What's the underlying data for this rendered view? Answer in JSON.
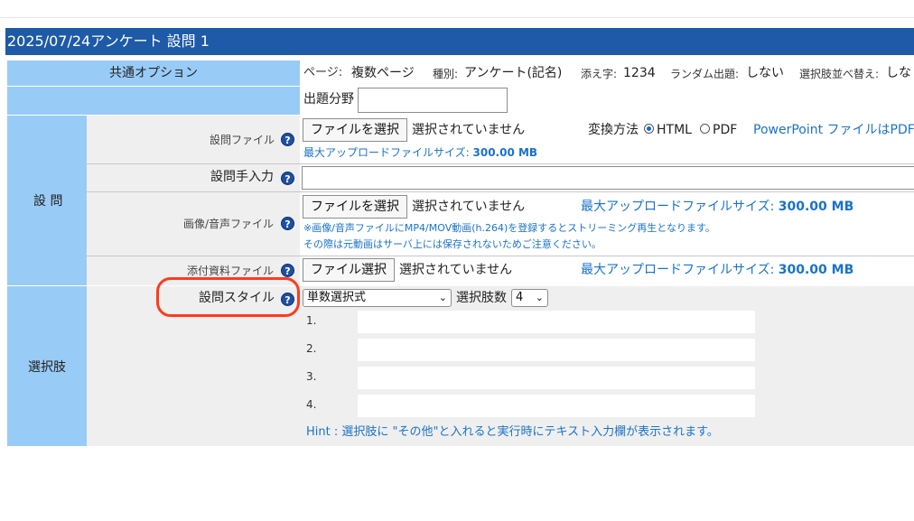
{
  "page": {
    "title": "2025/07/24アンケート  設問 1"
  },
  "common": {
    "label": "共通オプション",
    "page_label": "ページ:",
    "page_value": "複数ページ",
    "type_label": "種別:",
    "type_value": "アンケート(記名)",
    "suffix_label": "添え字:",
    "suffix_value": "1234",
    "random_label": "ランダム出題:",
    "random_value": "しない",
    "shuffle_label": "選択肢並べ替え:",
    "shuffle_value": "しな",
    "field_label": "出題分野",
    "field_value": ""
  },
  "question": {
    "section_label": "設 問",
    "file_label": "設問ファイル",
    "file_button": "ファイルを選択",
    "file_status": "選択されていません",
    "convert_label": "変換方法",
    "convert_html": "HTML",
    "convert_pdf": "PDF",
    "convert_selected": "HTML",
    "ppt_link": "PowerPoint ファイルはPDF",
    "file_max": "最大アップロードファイルサイズ: ",
    "file_max_value": "300.00 MB",
    "manual_label": "設問手入力",
    "manual_value": "",
    "media_label": "画像/音声ファイル",
    "media_button": "ファイルを選択",
    "media_status": "選択されていません",
    "media_max": "最大アップロードファイルサイズ: ",
    "media_max_value": "300.00 MB",
    "media_note1": "※画像/音声ファイルにMP4/MOV動画(h.264)を登録するとストリーミング再生となります。",
    "media_note2": "その際は元動画はサーバ上には保存されないためご注意ください。",
    "attach_label": "添付資料ファイル",
    "attach_button": "ファイル選択",
    "attach_status": "選択されていません",
    "attach_max": "最大アップロードファイルサイズ: ",
    "attach_max_value": "300.00 MB"
  },
  "choices": {
    "section_label": "選択肢",
    "style_label": "設問スタイル",
    "style_value": "単数選択式",
    "count_label": "選択肢数",
    "count_value": "4",
    "items": [
      {
        "num": "1.",
        "value": ""
      },
      {
        "num": "2.",
        "value": ""
      },
      {
        "num": "3.",
        "value": ""
      },
      {
        "num": "4.",
        "value": ""
      }
    ],
    "hint": "Hint : 選択肢に \"その他\"と入れると実行時にテキスト入力欄が表示されます。"
  },
  "icons": {
    "help": "?",
    "chevron": "⌄"
  },
  "colors": {
    "title_bar": "#1e5aa8",
    "section_bg": "#99cbf7",
    "label_bg": "#efefef",
    "link": "#1a73c8",
    "highlight": "#ff3b1a"
  }
}
